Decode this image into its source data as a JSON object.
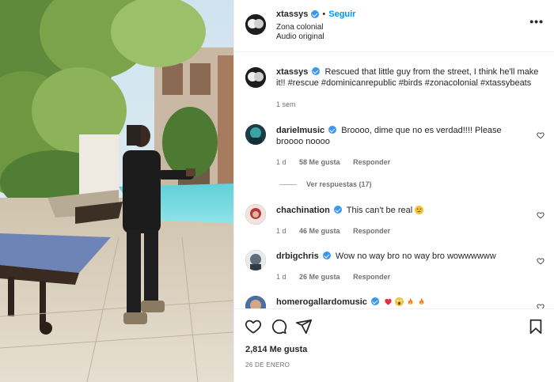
{
  "post": {
    "username": "xtassys",
    "follow_label": "Seguir",
    "separator": "•",
    "location": "Zona colonial",
    "audio": "Audio original",
    "more_label": "•••"
  },
  "caption": {
    "username": "xtassys",
    "text": "Rescued that little guy from the street, I think he'll make it!! #rescue #dominicanrepublic #birds #zonacolonial #xtassybeats",
    "time": "1 sem"
  },
  "comments": [
    {
      "username": "darielmusic",
      "text": "Broooo, dime que no es verdad!!!! Please broooo noooo",
      "time": "1 d",
      "likes": "58 Me gusta",
      "reply": "Responder",
      "view_replies": "Ver respuestas (17)"
    },
    {
      "username": "chachination",
      "text": "This can't be real",
      "emoji": "worried-face-emoji",
      "time": "1 d",
      "likes": "46 Me gusta",
      "reply": "Responder"
    },
    {
      "username": "drbigchris",
      "text": "Wow no way bro no way bro wowwwwww",
      "time": "1 d",
      "likes": "26 Me gusta",
      "reply": "Responder"
    },
    {
      "username": "homerogallardomusic",
      "emojis": [
        "red-heart-emoji",
        "screaming-face-emoji",
        "fire-emoji",
        "fire-emoji"
      ]
    }
  ],
  "actions": {
    "icons": [
      "heart-icon",
      "comment-icon",
      "share-icon",
      "bookmark-icon"
    ],
    "likes": "2,814 Me gusta",
    "date": "26 DE ENERO"
  },
  "colors": {
    "link_blue": "#0095f6",
    "verified_blue": "#3897f0",
    "muted_text": "#737373",
    "emoji_yellow": "#f4c33a",
    "heart_red": "#ed2b3e",
    "fire_orange": "#f47a1f"
  }
}
